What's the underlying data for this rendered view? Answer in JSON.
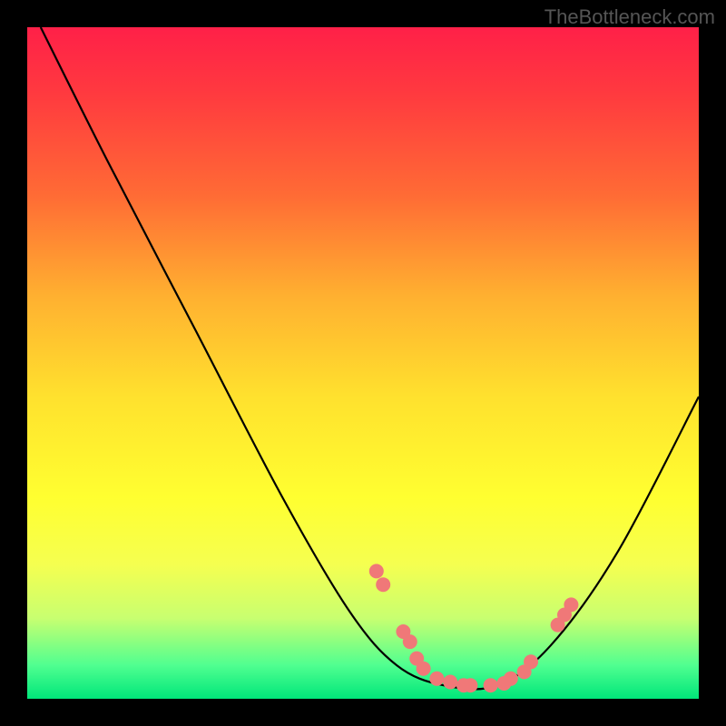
{
  "watermark": "TheBottleneck.com",
  "chart_data": {
    "type": "line",
    "title": "",
    "xlabel": "",
    "ylabel": "",
    "xlim": [
      0,
      100
    ],
    "ylim": [
      0,
      100
    ],
    "curve": {
      "name": "bottleneck-curve",
      "points": [
        {
          "x": 2,
          "y": 100
        },
        {
          "x": 12,
          "y": 80
        },
        {
          "x": 25,
          "y": 55
        },
        {
          "x": 38,
          "y": 30
        },
        {
          "x": 48,
          "y": 13
        },
        {
          "x": 55,
          "y": 5
        },
        {
          "x": 62,
          "y": 2
        },
        {
          "x": 70,
          "y": 2
        },
        {
          "x": 78,
          "y": 8
        },
        {
          "x": 88,
          "y": 22
        },
        {
          "x": 100,
          "y": 45
        }
      ]
    },
    "markers": [
      {
        "x": 52,
        "y": 19
      },
      {
        "x": 53,
        "y": 17
      },
      {
        "x": 56,
        "y": 10
      },
      {
        "x": 57,
        "y": 8.5
      },
      {
        "x": 58,
        "y": 6
      },
      {
        "x": 59,
        "y": 4.5
      },
      {
        "x": 61,
        "y": 3
      },
      {
        "x": 63,
        "y": 2.5
      },
      {
        "x": 65,
        "y": 2
      },
      {
        "x": 66,
        "y": 2
      },
      {
        "x": 69,
        "y": 2
      },
      {
        "x": 71,
        "y": 2.3
      },
      {
        "x": 72,
        "y": 3
      },
      {
        "x": 74,
        "y": 4
      },
      {
        "x": 75,
        "y": 5.5
      },
      {
        "x": 79,
        "y": 11
      },
      {
        "x": 80,
        "y": 12.5
      },
      {
        "x": 81,
        "y": 14
      }
    ],
    "marker_color": "#f07878",
    "marker_radius": 8
  }
}
